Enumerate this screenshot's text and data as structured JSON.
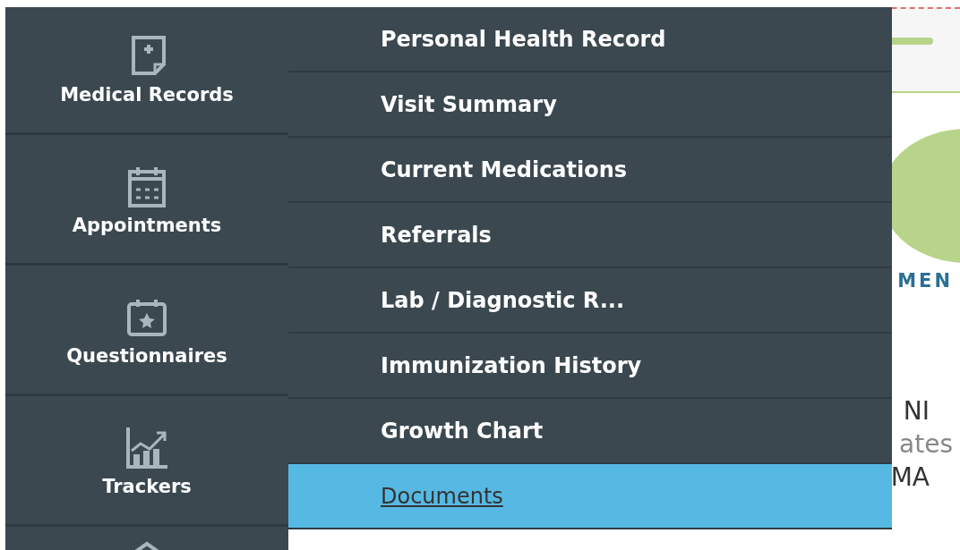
{
  "sidebar": {
    "items": [
      {
        "label": "Medical Records",
        "kind": "record"
      },
      {
        "label": "Appointments",
        "kind": "calendar"
      },
      {
        "label": "Questionnaires",
        "kind": "star-calendar"
      },
      {
        "label": "Trackers",
        "kind": "chart"
      }
    ]
  },
  "submenu": {
    "items": [
      {
        "label": "Personal Health Record",
        "selected": false
      },
      {
        "label": "Visit Summary",
        "selected": false
      },
      {
        "label": "Current Medications",
        "selected": false
      },
      {
        "label": "Referrals",
        "selected": false
      },
      {
        "label": "Lab / Diagnostic R...",
        "selected": false
      },
      {
        "label": "Immunization History",
        "selected": false
      },
      {
        "label": "Growth Chart",
        "selected": false
      },
      {
        "label": "Documents",
        "selected": true
      }
    ]
  },
  "background_page": {
    "heading": "MEN",
    "lines": [
      "NI",
      "ates",
      "MA"
    ]
  }
}
